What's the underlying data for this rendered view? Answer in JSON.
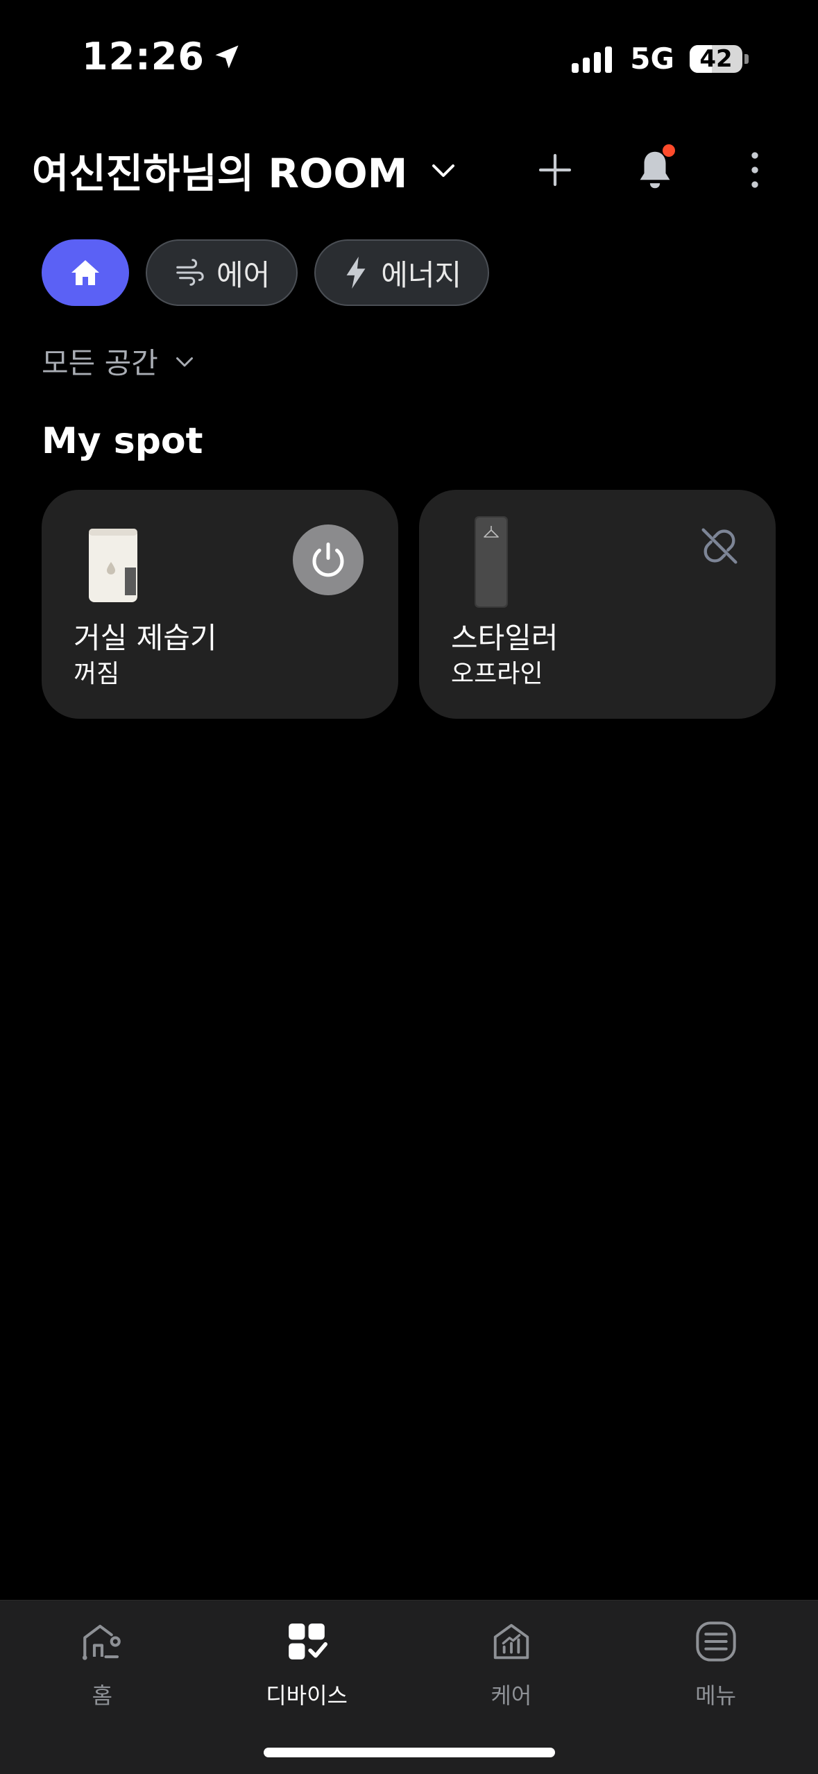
{
  "status_bar": {
    "time": "12:26",
    "network": "5G",
    "battery": "42",
    "battery_level": 0.42
  },
  "header": {
    "room_title": "여신진하님의 ROOM"
  },
  "filters": {
    "home_icon": "home-icon",
    "air_label": "에어",
    "energy_label": "에너지"
  },
  "space_selector": {
    "label": "모든 공간"
  },
  "section": {
    "title": "My spot"
  },
  "devices": [
    {
      "name": "거실 제습기",
      "status": "꺼짐",
      "icon": "dehumidifier-image",
      "action_icon": "power-icon"
    },
    {
      "name": "스타일러",
      "status": "오프라인",
      "icon": "styler-image",
      "action_icon": "unlink-icon"
    }
  ],
  "bottom_nav": {
    "items": [
      {
        "label": "홈",
        "icon": "home-outline-icon",
        "active": false
      },
      {
        "label": "디바이스",
        "icon": "devices-icon",
        "active": true
      },
      {
        "label": "케어",
        "icon": "care-icon",
        "active": false
      },
      {
        "label": "메뉴",
        "icon": "menu-icon",
        "active": false
      }
    ]
  },
  "colors": {
    "accent": "#5b61f5",
    "notification": "#ff4b2b",
    "card_bg": "#222222"
  }
}
